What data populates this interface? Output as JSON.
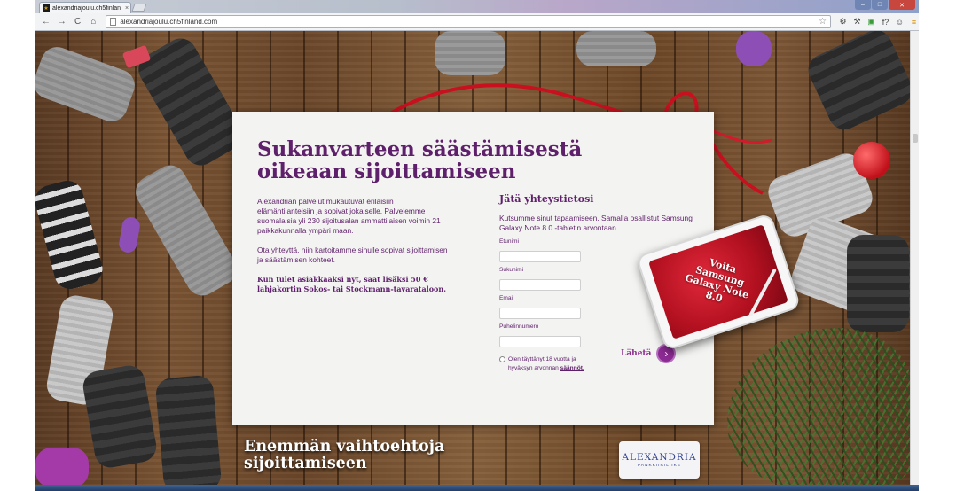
{
  "browser": {
    "tab_title": "alexandriajoulu.ch5finlan",
    "tab_close": "×",
    "url": "alexandriajoulu.ch5finland.com",
    "star": "☆",
    "back": "←",
    "forward": "→",
    "reload": "C",
    "home": "⌂",
    "extensions": [
      "⚙",
      "⚒",
      "▣",
      "f?",
      "☺",
      "≡"
    ],
    "window_min": "–",
    "window_max": "□",
    "window_close": "✕"
  },
  "page": {
    "headline": "Sukanvarteen säästämisestä oikeaan sijoittamiseen",
    "intro_paragraph": "Alexandrian palvelut mukautuvat erilaisiin elämäntilanteisiin ja sopivat jokaiselle. Palvelemme suomalaisia yli 230 sijoitusalan ammattilaisen voimin 21 paikkakunnalla ympäri maan.",
    "contact_paragraph": "Ota yhteyttä, niin kartoitamme sinulle sopivat sijoittamisen ja säästämisen kohteet.",
    "offer_paragraph": "Kun tulet asiakkaaksi nyt, saat lisäksi 50 € lahjakortin Sokos- tai Stockmann-tavarataloon.",
    "form": {
      "title": "Jätä yhteystietosi",
      "intro": "Kutsumme sinut tapaamiseen. Samalla osallistut Samsung Galaxy Note 8.0 -tabletin arvontaan.",
      "fields": [
        {
          "label": "Etunimi",
          "value": ""
        },
        {
          "label": "Sukunimi",
          "value": ""
        },
        {
          "label": "Email",
          "value": ""
        },
        {
          "label": "Puhelinnumero",
          "value": ""
        }
      ],
      "consent_text": "Olen täyttänyt 18 vuotta ja hyväksyn arvonnan",
      "consent_link": "säännöt.",
      "submit_label": "Lähetä",
      "submit_icon": "›"
    },
    "tablet_promo": "Voita Samsung Galaxy Note 8.0",
    "tagline": "Enemmän vaihtoehtoja sijoittamiseen",
    "logo": {
      "brand": "ALEXANDRIA",
      "sub": "PANKKIIRILIIKE"
    }
  },
  "colors": {
    "accent_purple": "#5e1f6b",
    "button_purple": "#8d2b94",
    "ribbon_red": "#c8101f",
    "logo_blue": "#2f3f8f"
  }
}
